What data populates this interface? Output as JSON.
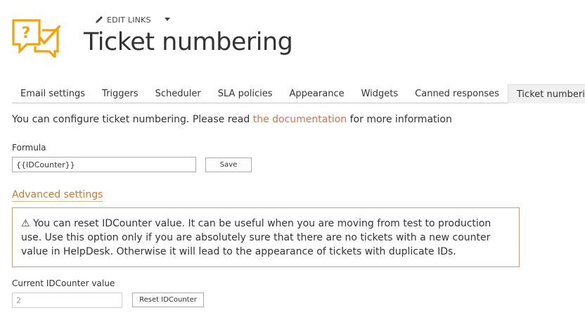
{
  "header": {
    "edit_links_label": "EDIT LINKS",
    "page_title": "Ticket numbering",
    "logo_color": "#F0A30A"
  },
  "tabs": [
    {
      "label": "Email settings",
      "active": false
    },
    {
      "label": "Triggers",
      "active": false
    },
    {
      "label": "Scheduler",
      "active": false
    },
    {
      "label": "SLA policies",
      "active": false
    },
    {
      "label": "Appearance",
      "active": false
    },
    {
      "label": "Widgets",
      "active": false
    },
    {
      "label": "Canned responses",
      "active": false
    },
    {
      "label": "Ticket numbering",
      "active": true
    }
  ],
  "intro": {
    "prefix": "You can configure ticket numbering. Please read ",
    "link_text": "the documentation",
    "suffix": " for more information"
  },
  "formula": {
    "label": "Formula",
    "value": "{{IDCounter}}",
    "save_label": "Save"
  },
  "advanced": {
    "heading": "Advanced settings",
    "warning_icon": "warning-triangle-icon",
    "warning_text": "⚠ You can reset IDCounter value. It can be useful when you are moving from test to production use. Use this option only if you are absolutely sure that there are no tickets with a new counter value in HelpDesk. Otherwise it will lead to the appearance of tickets with duplicate IDs."
  },
  "counter": {
    "label": "Current IDCounter value",
    "value": "2",
    "reset_label": "Reset IDCounter"
  },
  "colors": {
    "link": "#E1704F",
    "advanced": "#C77A2A",
    "warning_border": "#D4A03A"
  }
}
